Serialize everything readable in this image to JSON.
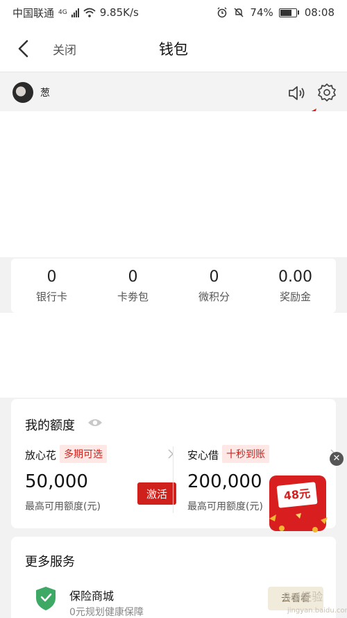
{
  "status_bar": {
    "carrier": "中国联通",
    "network": "4G",
    "speed": "9.85K/s",
    "battery": "74%",
    "battery_level": 0.74,
    "time": "08:08"
  },
  "nav": {
    "close_label": "关闭",
    "title": "钱包"
  },
  "user": {
    "name": "葱"
  },
  "stats": [
    {
      "value": "0",
      "label": "银行卡"
    },
    {
      "value": "0",
      "label": "卡劵包"
    },
    {
      "value": "0",
      "label": "微积分"
    },
    {
      "value": "0.00",
      "label": "奖励金"
    }
  ],
  "credit": {
    "title": "我的额度",
    "left": {
      "name": "放心花",
      "tag": "多期可选",
      "amount": "50,000",
      "sub": "最高可用额度(元)",
      "button": "激活"
    },
    "right": {
      "name": "安心借",
      "tag": "十秒到账",
      "amount": "200,000",
      "sub": "最高可用额度(元)"
    }
  },
  "promo": {
    "amount": "48元"
  },
  "services": {
    "title": "更多服务",
    "item_title": "保险商城",
    "item_sub": "0元规划健康保障",
    "item_button": "去看看"
  },
  "watermark": {
    "text": "Bai经验",
    "sub": "jingyan.baidu.com"
  },
  "colors": {
    "accent": "#d0201b",
    "arrow": "#e31c1c"
  }
}
